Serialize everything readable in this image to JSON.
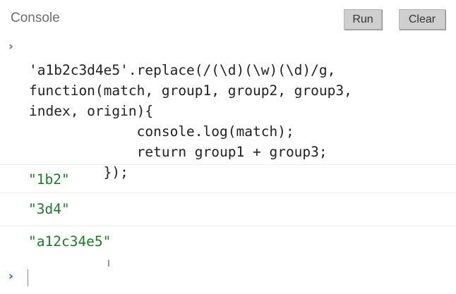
{
  "header": {
    "title": "Console",
    "run_label": "Run",
    "clear_label": "Clear"
  },
  "input": {
    "lines": [
      "'a1b2c3d4e5'.replace(/(\\d)(\\w)(\\d)/g,",
      "function(match, group1, group2, group3,",
      "index, origin){",
      "             console.log(match);",
      "             return group1 + group3;",
      "         });"
    ]
  },
  "outputs": [
    "\"1b2\"",
    "\"3d4\"",
    "\"a12c34e5\""
  ],
  "prompt": {
    "chevron": "›"
  }
}
